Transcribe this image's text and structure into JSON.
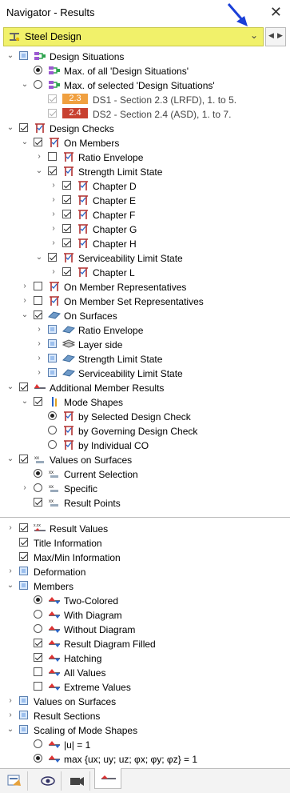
{
  "window": {
    "title": "Navigator - Results"
  },
  "combo": {
    "value": "Steel Design"
  },
  "tree": [
    {
      "key": "ds",
      "type": "checkbox",
      "state": "partial",
      "level": 0,
      "expander": "open",
      "icon": "design-situation-icon",
      "label": "Design Situations"
    },
    {
      "key": "ds-max-all",
      "type": "radio",
      "state": "on",
      "level": 1,
      "expander": "none",
      "icon": "design-situation-icon",
      "label": "Max. of all 'Design Situations'"
    },
    {
      "key": "ds-max-sel",
      "type": "radio",
      "state": "off",
      "level": 1,
      "expander": "open",
      "icon": "design-situation-icon",
      "label": "Max. of selected 'Design Situations'"
    },
    {
      "key": "ds1",
      "type": "checkbox",
      "state": "grey-checked",
      "level": 2,
      "expander": "none",
      "badge": "2.3",
      "badgeColor": "#f0a040",
      "label": "DS1 - Section 2.3 (LRFD), 1. to 5."
    },
    {
      "key": "ds2",
      "type": "checkbox",
      "state": "grey-checked",
      "level": 2,
      "expander": "none",
      "badge": "2.4",
      "badgeColor": "#c84030",
      "label": "DS2 - Section 2.4 (ASD), 1. to 7."
    },
    {
      "key": "dc",
      "type": "checkbox",
      "state": "checked",
      "level": 0,
      "expander": "open",
      "icon": "member-check-icon",
      "label": "Design Checks"
    },
    {
      "key": "dc-om",
      "type": "checkbox",
      "state": "checked",
      "level": 1,
      "expander": "open",
      "icon": "member-check-icon",
      "label": "On Members"
    },
    {
      "key": "dc-om-re",
      "type": "checkbox",
      "state": "off",
      "level": 2,
      "expander": "closed",
      "icon": "member-check-icon",
      "label": "Ratio Envelope"
    },
    {
      "key": "dc-om-sls",
      "type": "checkbox",
      "state": "checked",
      "level": 2,
      "expander": "open",
      "icon": "member-check-icon",
      "label": "Strength Limit State"
    },
    {
      "key": "ch-d",
      "type": "checkbox",
      "state": "checked",
      "level": 3,
      "expander": "closed",
      "icon": "member-check-icon",
      "label": "Chapter D"
    },
    {
      "key": "ch-e",
      "type": "checkbox",
      "state": "checked",
      "level": 3,
      "expander": "closed",
      "icon": "member-check-icon",
      "label": "Chapter E"
    },
    {
      "key": "ch-f",
      "type": "checkbox",
      "state": "checked",
      "level": 3,
      "expander": "closed",
      "icon": "member-check-icon",
      "label": "Chapter F"
    },
    {
      "key": "ch-g",
      "type": "checkbox",
      "state": "checked",
      "level": 3,
      "expander": "closed",
      "icon": "member-check-icon",
      "label": "Chapter G"
    },
    {
      "key": "ch-h",
      "type": "checkbox",
      "state": "checked",
      "level": 3,
      "expander": "closed",
      "icon": "member-check-icon",
      "label": "Chapter H"
    },
    {
      "key": "dc-om-svc",
      "type": "checkbox",
      "state": "checked",
      "level": 2,
      "expander": "open",
      "icon": "member-check-icon",
      "label": "Serviceability Limit State"
    },
    {
      "key": "ch-l",
      "type": "checkbox",
      "state": "checked",
      "level": 3,
      "expander": "closed",
      "icon": "member-check-icon",
      "label": "Chapter L"
    },
    {
      "key": "dc-omr",
      "type": "checkbox",
      "state": "off",
      "level": 1,
      "expander": "closed",
      "icon": "member-check-icon",
      "label": "On Member Representatives"
    },
    {
      "key": "dc-omsr",
      "type": "checkbox",
      "state": "off",
      "level": 1,
      "expander": "closed",
      "icon": "member-check-icon",
      "label": "On Member Set Representatives"
    },
    {
      "key": "dc-os",
      "type": "checkbox",
      "state": "checked",
      "level": 1,
      "expander": "open",
      "icon": "surface-icon",
      "label": "On Surfaces"
    },
    {
      "key": "dc-os-re",
      "type": "checkbox",
      "state": "partial",
      "level": 2,
      "expander": "closed",
      "icon": "surface-icon",
      "label": "Ratio Envelope"
    },
    {
      "key": "dc-os-ls",
      "type": "checkbox",
      "state": "partial",
      "level": 2,
      "expander": "closed",
      "icon": "layers-icon",
      "label": "Layer side"
    },
    {
      "key": "dc-os-sls",
      "type": "checkbox",
      "state": "partial",
      "level": 2,
      "expander": "closed",
      "icon": "surface-icon",
      "label": "Strength Limit State"
    },
    {
      "key": "dc-os-svc",
      "type": "checkbox",
      "state": "partial",
      "level": 2,
      "expander": "closed",
      "icon": "surface-icon",
      "label": "Serviceability Limit State"
    },
    {
      "key": "amr",
      "type": "checkbox",
      "state": "checked",
      "level": 0,
      "expander": "open",
      "icon": "member-result-icon",
      "label": "Additional Member Results"
    },
    {
      "key": "amr-ms",
      "type": "checkbox",
      "state": "checked",
      "level": 1,
      "expander": "open",
      "icon": "mode-shape-icon",
      "label": "Mode Shapes"
    },
    {
      "key": "amr-ms-sel",
      "type": "radio",
      "state": "on",
      "level": 2,
      "expander": "none",
      "icon": "member-check-icon",
      "label": "by Selected Design Check"
    },
    {
      "key": "amr-ms-gov",
      "type": "radio",
      "state": "off",
      "level": 2,
      "expander": "none",
      "icon": "member-check-icon",
      "label": "by Governing Design Check"
    },
    {
      "key": "amr-ms-ind",
      "type": "radio",
      "state": "off",
      "level": 2,
      "expander": "none",
      "icon": "member-check-icon",
      "label": "by Individual CO"
    },
    {
      "key": "vos",
      "type": "checkbox",
      "state": "checked",
      "level": 0,
      "expander": "open",
      "icon": "values-icon",
      "label": "Values on Surfaces"
    },
    {
      "key": "vos-cur",
      "type": "radio",
      "state": "on",
      "level": 1,
      "expander": "none",
      "icon": "values-icon",
      "label": "Current Selection"
    },
    {
      "key": "vos-spec",
      "type": "radio",
      "state": "off",
      "level": 1,
      "expander": "closed",
      "icon": "values-icon",
      "label": "Specific"
    },
    {
      "key": "vos-rp",
      "type": "checkbox",
      "state": "checked",
      "level": 1,
      "expander": "none",
      "icon": "values-icon",
      "label": "Result Points"
    }
  ],
  "tree2": [
    {
      "key": "rv",
      "type": "checkbox",
      "state": "checked",
      "level": 0,
      "expander": "closed",
      "icon": "result-values-icon",
      "label": "Result Values"
    },
    {
      "key": "ti",
      "type": "checkbox",
      "state": "checked",
      "level": 0,
      "expander": "none",
      "icon": "",
      "label": "Title Information"
    },
    {
      "key": "mm",
      "type": "checkbox",
      "state": "checked",
      "level": 0,
      "expander": "none",
      "icon": "",
      "label": "Max/Min Information"
    },
    {
      "key": "def",
      "type": "checkbox",
      "state": "partial",
      "level": 0,
      "expander": "closed",
      "icon": "",
      "label": "Deformation"
    },
    {
      "key": "mem",
      "type": "checkbox",
      "state": "partial",
      "level": 0,
      "expander": "open",
      "icon": "",
      "label": "Members"
    },
    {
      "key": "mem-2c",
      "type": "radio",
      "state": "on",
      "level": 1,
      "expander": "none",
      "icon": "member-display-icon",
      "label": "Two-Colored"
    },
    {
      "key": "mem-wd",
      "type": "radio",
      "state": "off",
      "level": 1,
      "expander": "none",
      "icon": "member-display-icon",
      "label": "With Diagram"
    },
    {
      "key": "mem-wod",
      "type": "radio",
      "state": "off",
      "level": 1,
      "expander": "none",
      "icon": "member-display-icon",
      "label": "Without Diagram"
    },
    {
      "key": "mem-rdf",
      "type": "checkbox",
      "state": "checked",
      "level": 1,
      "expander": "none",
      "icon": "member-display-icon",
      "label": "Result Diagram Filled"
    },
    {
      "key": "mem-hat",
      "type": "checkbox",
      "state": "checked",
      "level": 1,
      "expander": "none",
      "icon": "member-display-icon",
      "label": "Hatching"
    },
    {
      "key": "mem-av",
      "type": "checkbox",
      "state": "off",
      "level": 1,
      "expander": "none",
      "icon": "member-display-icon",
      "label": "All Values"
    },
    {
      "key": "mem-ev",
      "type": "checkbox",
      "state": "off",
      "level": 1,
      "expander": "none",
      "icon": "member-display-icon",
      "label": "Extreme Values"
    },
    {
      "key": "vos2",
      "type": "checkbox",
      "state": "partial",
      "level": 0,
      "expander": "closed",
      "icon": "",
      "label": "Values on Surfaces"
    },
    {
      "key": "rs",
      "type": "checkbox",
      "state": "partial",
      "level": 0,
      "expander": "closed",
      "icon": "",
      "label": "Result Sections"
    },
    {
      "key": "sms",
      "type": "checkbox",
      "state": "partial",
      "level": 0,
      "expander": "open",
      "icon": "",
      "label": "Scaling of Mode Shapes"
    },
    {
      "key": "sms-u",
      "type": "radio",
      "state": "off",
      "level": 1,
      "expander": "none",
      "icon": "member-display-icon",
      "label": "|u| = 1"
    },
    {
      "key": "sms-max",
      "type": "radio",
      "state": "on",
      "level": 1,
      "expander": "none",
      "icon": "member-display-icon",
      "label": "max {ux; uy; uz; φx; φy; φz} = 1"
    }
  ],
  "tabs": [
    {
      "name": "data-tab",
      "icon": "data-icon"
    },
    {
      "name": "view-tab",
      "icon": "eye-icon"
    },
    {
      "name": "video-tab",
      "icon": "camera-icon"
    },
    {
      "name": "results-tab",
      "icon": "results-icon"
    }
  ]
}
